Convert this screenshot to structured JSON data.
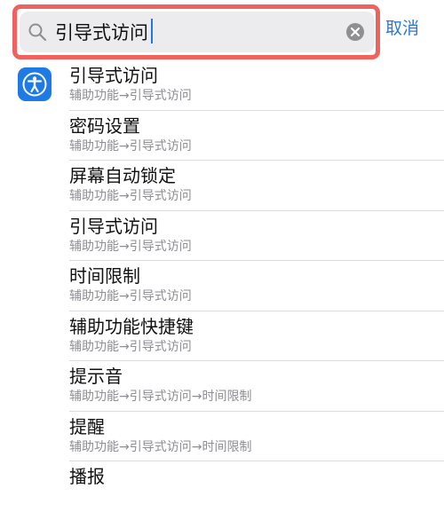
{
  "search": {
    "query": "引导式访问",
    "cancel_label": "取消"
  },
  "colors": {
    "accent": "#2979d6",
    "highlight_border": "#f0625f",
    "app_icon_bg": "#1e7ae4"
  },
  "app_icon": "accessibility-icon",
  "results": [
    {
      "title": "引导式访问",
      "path": "辅助功能→引导式访问"
    },
    {
      "title": "密码设置",
      "path": "辅助功能→引导式访问"
    },
    {
      "title": "屏幕自动锁定",
      "path": "辅助功能→引导式访问"
    },
    {
      "title": "引导式访问",
      "path": "辅助功能→引导式访问"
    },
    {
      "title": "时间限制",
      "path": "辅助功能→引导式访问"
    },
    {
      "title": "辅助功能快捷键",
      "path": "辅助功能→引导式访问"
    },
    {
      "title": "提示音",
      "path": "辅助功能→引导式访问→时间限制"
    },
    {
      "title": "提醒",
      "path": "辅助功能→引导式访问→时间限制"
    },
    {
      "title": "播报",
      "path": ""
    }
  ]
}
